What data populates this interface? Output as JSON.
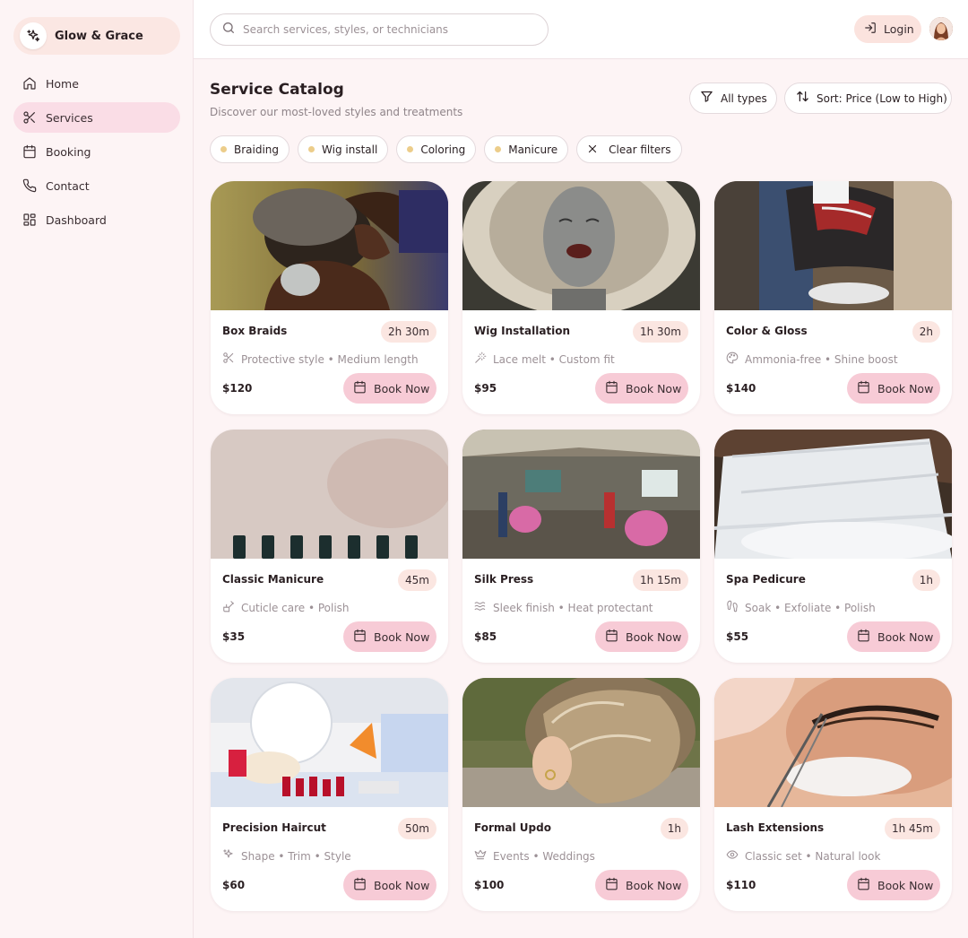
{
  "brand": {
    "name": "Glow & Grace"
  },
  "nav": [
    {
      "label": "Home",
      "icon": "home-icon",
      "active": false
    },
    {
      "label": "Services",
      "icon": "scissors-icon",
      "active": true
    },
    {
      "label": "Booking",
      "icon": "calendar-icon",
      "active": false
    },
    {
      "label": "Contact",
      "icon": "phone-icon",
      "active": false
    },
    {
      "label": "Dashboard",
      "icon": "grid-icon",
      "active": false
    }
  ],
  "header": {
    "search_placeholder": "Search services, styles, or technicians",
    "login_label": "Login"
  },
  "page": {
    "title": "Service Catalog",
    "subtitle": "Discover our most-loved styles and treatments",
    "type_filter": "All types",
    "sort_label": "Sort: Price (Low to High)"
  },
  "chips": [
    "Braiding",
    "Wig install",
    "Coloring",
    "Manicure"
  ],
  "clear_filters_label": "Clear filters",
  "book_label": "Book Now",
  "services": [
    {
      "title": "Box Braids",
      "duration": "2h 30m",
      "desc": "Protective style • Medium length",
      "price": "$120",
      "icon": "scissors-icon"
    },
    {
      "title": "Wig Installation",
      "duration": "1h 30m",
      "desc": "Lace melt • Custom fit",
      "price": "$95",
      "icon": "wand-icon"
    },
    {
      "title": "Color & Gloss",
      "duration": "2h",
      "desc": "Ammonia-free • Shine boost",
      "price": "$140",
      "icon": "palette-icon"
    },
    {
      "title": "Classic Manicure",
      "duration": "45m",
      "desc": "Cuticle care • Polish",
      "price": "$35",
      "icon": "nail-brush-icon"
    },
    {
      "title": "Silk Press",
      "duration": "1h 15m",
      "desc": "Sleek finish • Heat protectant",
      "price": "$85",
      "icon": "waves-icon"
    },
    {
      "title": "Spa Pedicure",
      "duration": "1h",
      "desc": "Soak • Exfoliate • Polish",
      "price": "$55",
      "icon": "footprints-icon"
    },
    {
      "title": "Precision Haircut",
      "duration": "50m",
      "desc": "Shape • Trim • Style",
      "price": "$60",
      "icon": "sparkles-icon"
    },
    {
      "title": "Formal Updo",
      "duration": "1h",
      "desc": "Events • Weddings",
      "price": "$100",
      "icon": "crown-icon"
    },
    {
      "title": "Lash Extensions",
      "duration": "1h 45m",
      "desc": "Classic set • Natural look",
      "price": "$110",
      "icon": "eye-icon"
    }
  ],
  "colors": {
    "accent": "#f7cbd6",
    "nav_active": "#fadde6",
    "brand_bg": "#fbe7e3",
    "duration_bg": "#fbe6e1",
    "chip_dot": "#eccd8a"
  }
}
